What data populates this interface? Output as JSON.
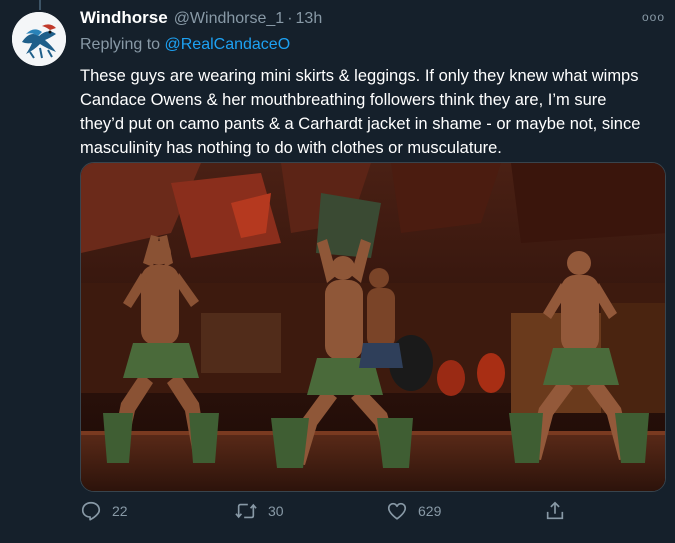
{
  "tweet": {
    "display_name": "Windhorse",
    "handle": "@Windhorse_1",
    "separator": "·",
    "time": "13h",
    "more_label": "ooo",
    "replying_prefix": "Replying to",
    "replying_to": "@RealCandaceO",
    "text": "These guys are wearing mini skirts & leggings. If only they knew what wimps Candace Owens & her mouthbreathing followers think they are, I’m sure they’d put on camo pants & a Carhardt jacket in shame - or maybe not, since masculinity has nothing to do with clothes or musculature."
  },
  "actions": {
    "replies": "22",
    "retweets": "30",
    "likes": "629"
  },
  "icons": {
    "reply": "reply-icon",
    "retweet": "retweet-icon",
    "like": "heart-icon",
    "share": "share-icon",
    "more": "more-icon"
  },
  "colors": {
    "background": "#15202b",
    "text": "#ffffff",
    "secondary": "#8899a6",
    "link": "#1da1f2"
  }
}
